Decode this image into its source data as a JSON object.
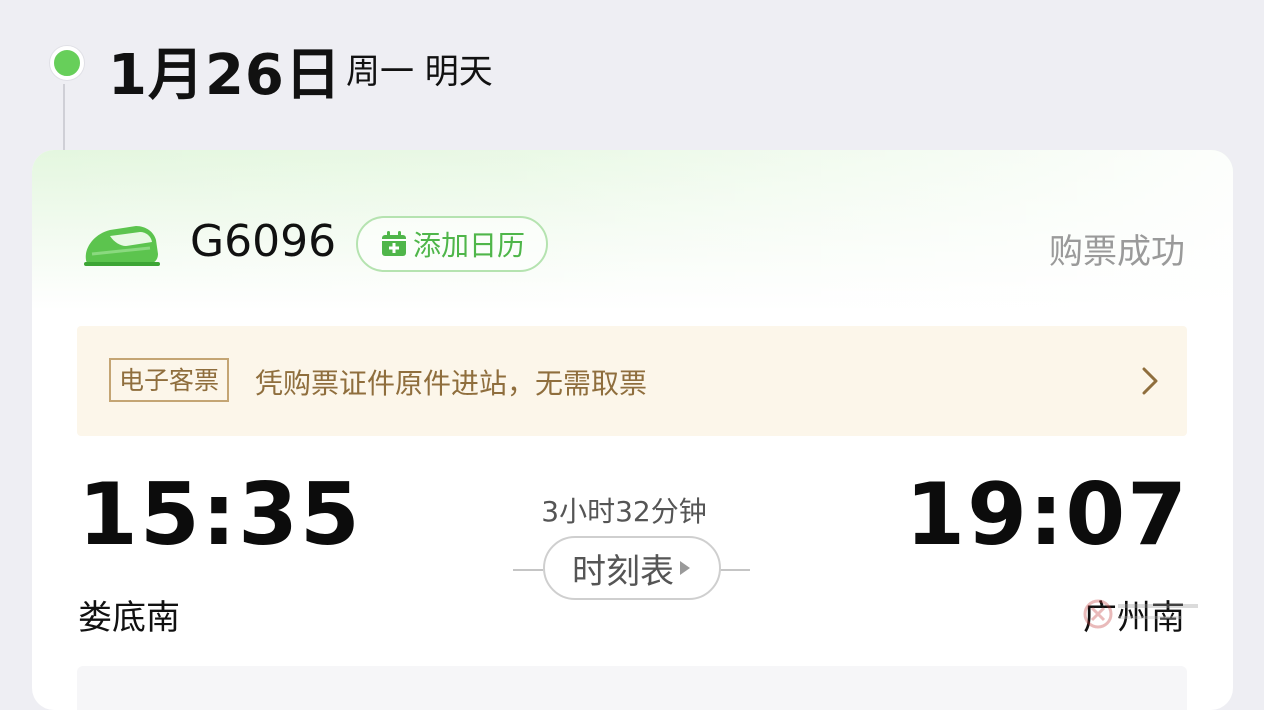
{
  "header": {
    "date": "1月26日",
    "weekday_label": "周一 明天"
  },
  "trip": {
    "train_number": "G6096",
    "add_calendar_label": "添加日历",
    "status": "购票成功",
    "notice": {
      "badge": "电子客票",
      "text": "凭购票证件原件进站，无需取票"
    },
    "departure": {
      "time": "15:35",
      "station": "娄底南"
    },
    "arrival": {
      "time": "19:07",
      "station": "广州南"
    },
    "duration": "3小时32分钟",
    "schedule_label": "时刻表"
  },
  "colors": {
    "accent_green": "#67cf5a",
    "notice_brown": "#8f6e3d",
    "notice_bg": "#fcf6ea",
    "status_gray": "#9a9a9a"
  },
  "icons": [
    "train-icon",
    "calendar-add-icon",
    "chevron-right-icon",
    "play-triangle-icon",
    "timeline-dot-icon"
  ]
}
